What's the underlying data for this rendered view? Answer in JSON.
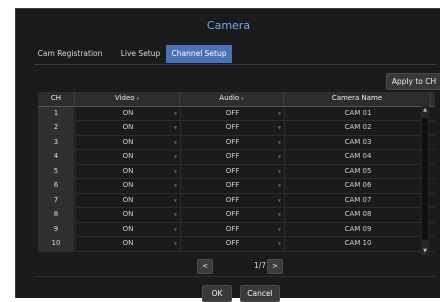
{
  "dialog": {
    "title": "Camera"
  },
  "tabs": [
    {
      "label": "Cam Registration",
      "active": false
    },
    {
      "label": "Live Setup",
      "active": false
    },
    {
      "label": "Channel Setup",
      "active": true
    }
  ],
  "apply_button_label": "Apply to CH",
  "table": {
    "headers": {
      "ch": "CH",
      "video": "Video",
      "audio": "Audio",
      "name": "Camera Name"
    },
    "rows": [
      {
        "ch": "1",
        "video": "ON",
        "audio": "OFF",
        "name": "CAM 01"
      },
      {
        "ch": "2",
        "video": "ON",
        "audio": "OFF",
        "name": "CAM 02"
      },
      {
        "ch": "3",
        "video": "ON",
        "audio": "OFF",
        "name": "CAM 03"
      },
      {
        "ch": "4",
        "video": "ON",
        "audio": "OFF",
        "name": "CAM 04"
      },
      {
        "ch": "5",
        "video": "ON",
        "audio": "OFF",
        "name": "CAM 05"
      },
      {
        "ch": "6",
        "video": "ON",
        "audio": "OFF",
        "name": "CAM 06"
      },
      {
        "ch": "7",
        "video": "ON",
        "audio": "OFF",
        "name": "CAM 07"
      },
      {
        "ch": "8",
        "video": "ON",
        "audio": "OFF",
        "name": "CAM 08"
      },
      {
        "ch": "9",
        "video": "ON",
        "audio": "OFF",
        "name": "CAM 09"
      },
      {
        "ch": "10",
        "video": "ON",
        "audio": "OFF",
        "name": "CAM 10"
      }
    ]
  },
  "pagination": {
    "prev": "<",
    "page": "1/7",
    "next": ">"
  },
  "footer": {
    "ok": "OK",
    "cancel": "Cancel"
  },
  "colors": {
    "panel_bg": "#1b1b1b",
    "accent": "#4b72b8",
    "title": "#6fa8ff"
  }
}
